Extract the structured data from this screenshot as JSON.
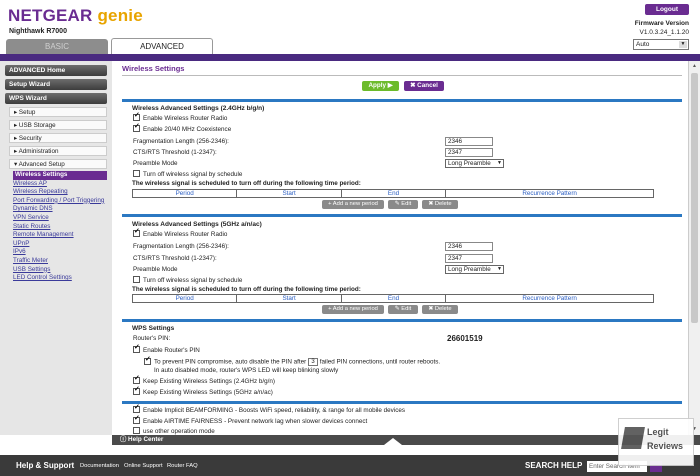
{
  "header": {
    "brand_main": "NETGEAR",
    "brand_genie": "genie",
    "model": "Nighthawk R7000",
    "logout": "Logout",
    "firmware_label": "Firmware Version",
    "firmware_value": "V1.0.3.24_1.1.20",
    "language": "Auto"
  },
  "tabs": {
    "basic": "BASIC",
    "advanced": "ADVANCED"
  },
  "sidebar": {
    "advanced_home": "ADVANCED Home",
    "setup_wizard": "Setup Wizard",
    "wps_wizard": "WPS Wizard",
    "setup": "▸ Setup",
    "usb_storage": "▸ USB Storage",
    "security": "▸ Security",
    "administration": "▸ Administration",
    "advanced_setup": "▾ Advanced Setup",
    "links": [
      "Wireless Settings",
      "Wireless AP",
      "Wireless Repeating",
      "Port Forwarding / Port Triggering",
      "Dynamic DNS",
      "VPN Service",
      "Static Routes",
      "Remote Management",
      "UPnP",
      "IPv6",
      "Traffic Meter",
      "USB Settings",
      "LED Control Settings"
    ]
  },
  "page": {
    "title": "Wireless Settings",
    "apply": "Apply ▶",
    "cancel": "✖ Cancel"
  },
  "band24": {
    "title": "Wireless Advanced Settings (2.4GHz b/g/n)",
    "enable_radio": "Enable Wireless Router Radio",
    "coexist": "Enable 20/40 MHz Coexistence",
    "frag_label": "Fragmentation Length (256-2346):",
    "frag_value": "2346",
    "rts_label": "CTS/RTS Threshold (1-2347):",
    "rts_value": "2347",
    "preamble_label": "Preamble Mode",
    "preamble_value": "Long Preamble",
    "schedule_off": "Turn off wireless signal by schedule",
    "schedule_note": "The wireless signal is scheduled to turn off during the following time period:"
  },
  "band5": {
    "title": "Wireless Advanced Settings (5GHz a/n/ac)",
    "enable_radio": "Enable Wireless Router Radio",
    "frag_label": "Fragmentation Length (256-2346):",
    "frag_value": "2346",
    "rts_label": "CTS/RTS Threshold (1-2347):",
    "rts_value": "2347",
    "preamble_label": "Preamble Mode",
    "preamble_value": "Long Preamble",
    "schedule_off": "Turn off wireless signal by schedule",
    "schedule_note": "The wireless signal is scheduled to turn off during the following time period:"
  },
  "schedule_table": {
    "columns": [
      "Period",
      "Start",
      "End",
      "Recurrence Pattern"
    ],
    "add": "+ Add a new period",
    "edit": "✎ Edit",
    "delete": "✖ Delete"
  },
  "wps": {
    "title": "WPS Settings",
    "pin_label": "Router's PIN:",
    "pin_value": "26601519",
    "enable_pin": "Enable Router's PIN",
    "prevent_pre": "To prevent PIN compromise, auto disable the PIN after",
    "prevent_count": "3",
    "prevent_post": "failed PIN connections, until router reboots.",
    "auto_disabled": "In auto disabled mode, router's WPS LED will keep blinking slowly",
    "keep24": "Keep Existing Wireless Settings (2.4GHz b/g/n)",
    "keep5": "Keep Existing Wireless Settings (5GHz a/n/ac)"
  },
  "extra": {
    "beamforming": "Enable Implicit BEAMFORMING - Boosts WiFi speed, reliability, & range for all mobile devices",
    "airtime": "Enable AIRTIME FAIRNESS - Prevent network lag when slower devices connect",
    "other_mode": "use other operation mode"
  },
  "help_center": "ⓘ Help Center",
  "footer": {
    "help_support": "Help & Support",
    "documentation": "Documentation",
    "online_support": "Online Support",
    "router_faq": "Router FAQ",
    "search_help": "SEARCH HELP",
    "search_placeholder": "Enter Search Item"
  },
  "watermark": {
    "line1": "Legit",
    "line2": "Reviews"
  }
}
